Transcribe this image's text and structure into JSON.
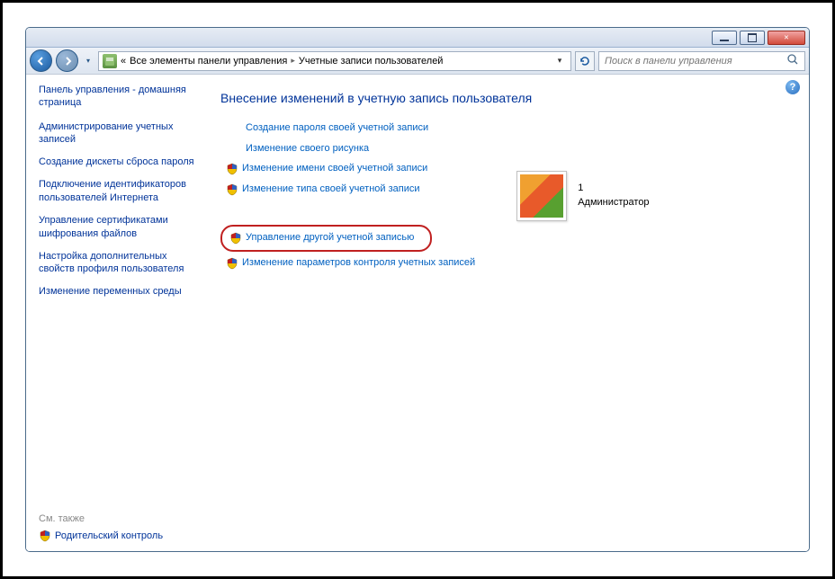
{
  "breadcrumbs": {
    "root_prefix": "«",
    "root": "Все элементы панели управления",
    "current": "Учетные записи пользователей"
  },
  "search": {
    "placeholder": "Поиск в панели управления"
  },
  "sidebar": {
    "home": "Панель управления - домашняя страница",
    "links": [
      "Администрирование учетных записей",
      "Создание дискеты сброса пароля",
      "Подключение идентификаторов пользователей Интернета",
      "Управление сертификатами шифрования файлов",
      "Настройка дополнительных свойств профиля пользователя",
      "Изменение переменных среды"
    ],
    "see_also": "См. также",
    "parental": "Родительский контроль"
  },
  "main": {
    "heading": "Внесение изменений в учетную запись пользователя",
    "tasks_plain": [
      "Создание пароля своей учетной записи",
      "Изменение своего рисунка"
    ],
    "tasks_shield": [
      "Изменение имени своей учетной записи",
      "Изменение типа своей учетной записи"
    ],
    "task_highlight": "Управление другой учетной записью",
    "task_after": "Изменение параметров контроля учетных записей",
    "account": {
      "name": "1",
      "role": "Администратор"
    }
  }
}
